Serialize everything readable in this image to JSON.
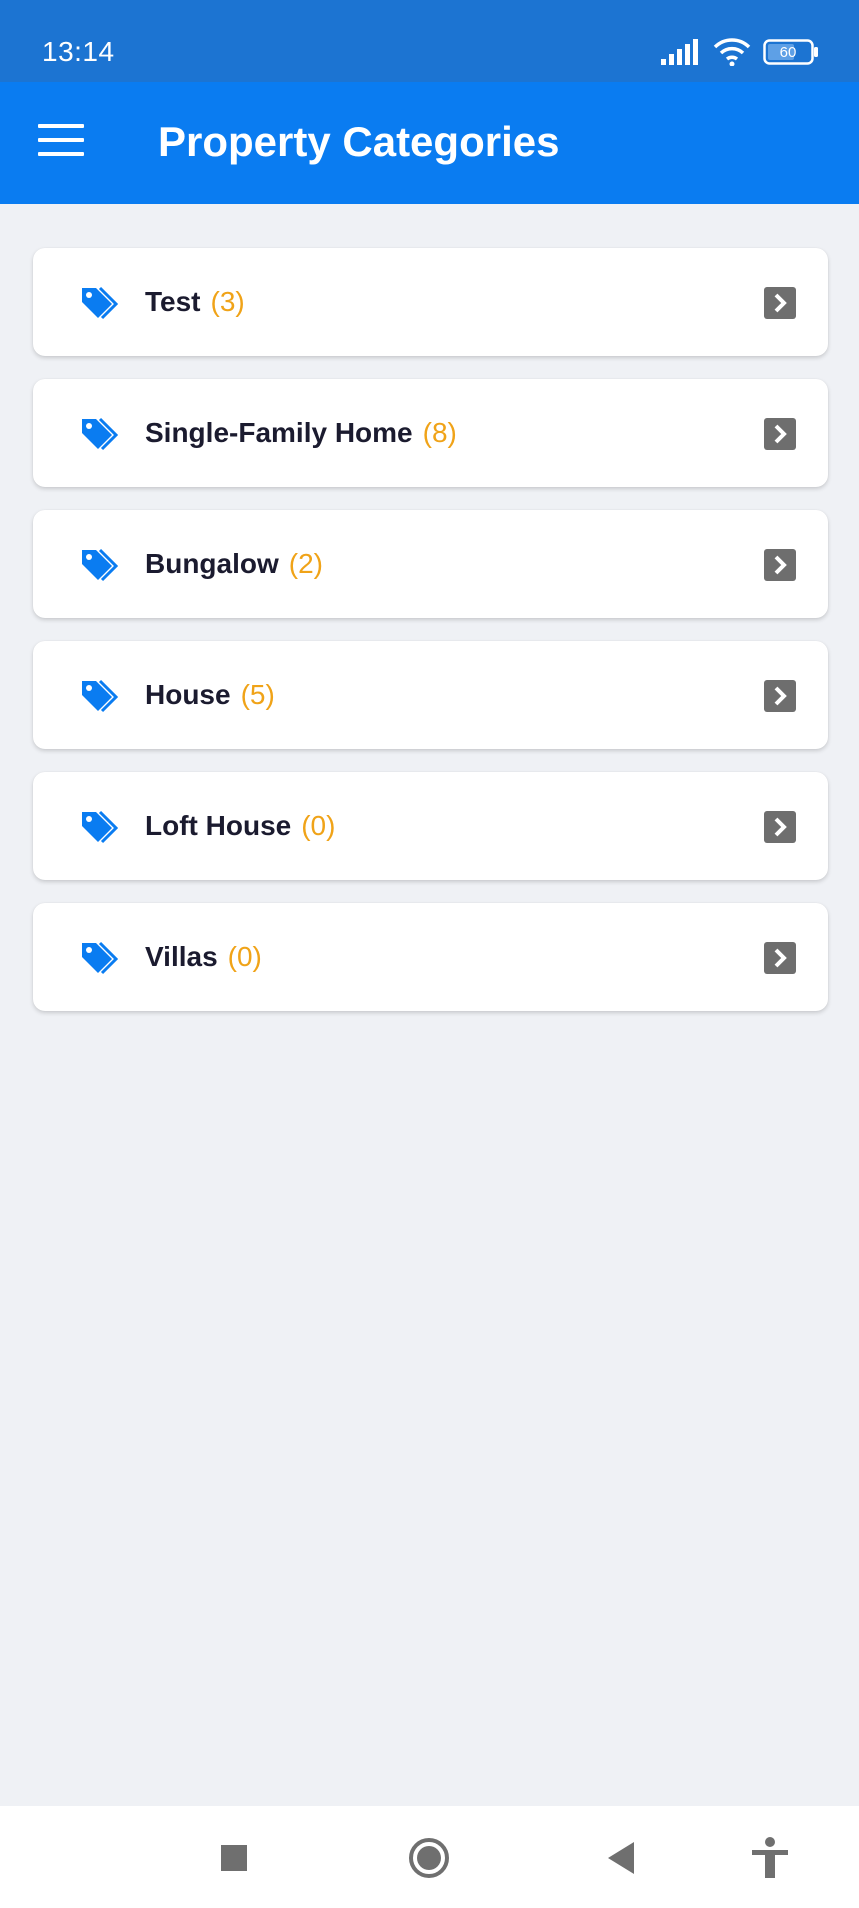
{
  "status_bar": {
    "time": "13:14",
    "battery": "60",
    "icons": [
      "signal-icon",
      "wifi-icon",
      "battery-icon"
    ]
  },
  "app_bar": {
    "title": "Property Categories",
    "menu_icon": "hamburger-menu-icon"
  },
  "categories": [
    {
      "name": "Test",
      "count": "(3)"
    },
    {
      "name": "Single-Family Home",
      "count": "(8)"
    },
    {
      "name": "Bungalow",
      "count": "(2)"
    },
    {
      "name": "House",
      "count": "(5)"
    },
    {
      "name": "Loft House",
      "count": "(0)"
    },
    {
      "name": "Villas",
      "count": "(0)"
    }
  ],
  "nav_bar": {
    "buttons": [
      "recents-square-icon",
      "home-circle-icon",
      "back-triangle-icon",
      "accessibility-icon"
    ]
  },
  "colors": {
    "status_bar": "#1c74d2",
    "app_bar": "#0a7cf1",
    "background": "#eff1f5",
    "tag_icon": "#0a7cf1",
    "count": "#f0a318",
    "chevron": "#6e6e6e"
  }
}
